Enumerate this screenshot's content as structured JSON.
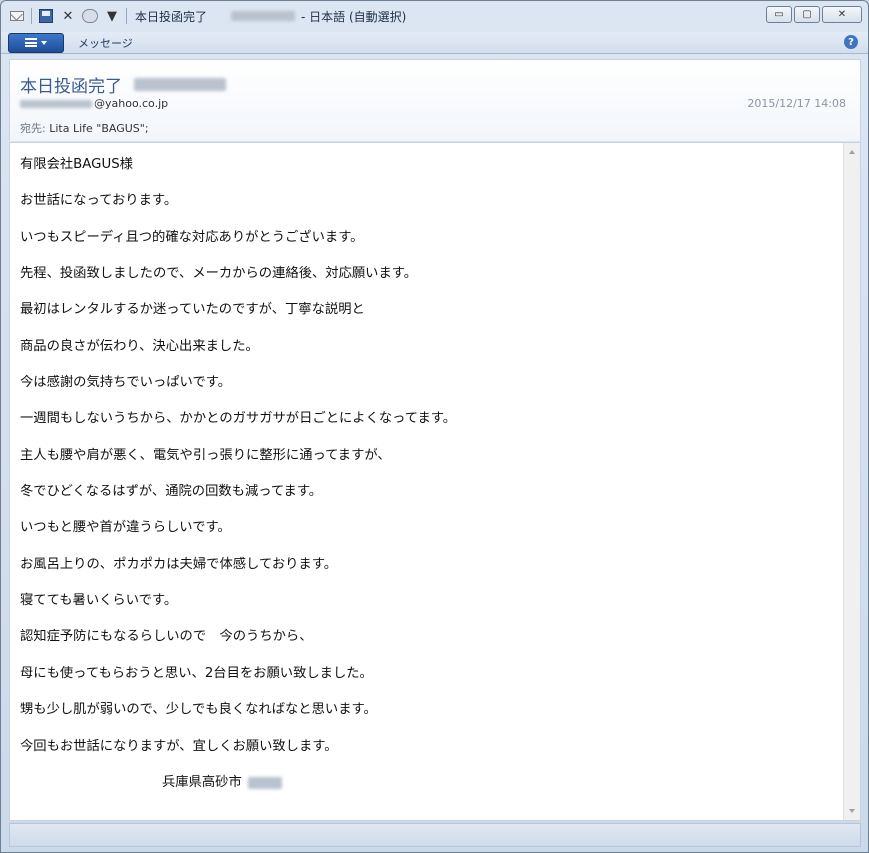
{
  "window": {
    "title": "本日投函完了",
    "title_suffix": "- 日本語 (自動選択)",
    "minimize": "▭",
    "maximize": "▢",
    "close": "✕"
  },
  "ribbon": {
    "tab_message": "メッセージ",
    "help": "?"
  },
  "header": {
    "subject": "本日投函完了",
    "from_domain": "@yahoo.co.jp",
    "date": "2015/12/17 14:08",
    "to_label": "宛先:",
    "to_value": "Lita Life \"BAGUS\";"
  },
  "body": {
    "lines": [
      "有限会社BAGUS様",
      "お世話になっております。",
      "いつもスピーディ且つ的確な対応ありがとうございます。",
      "先程、投函致しましたので、メーカからの連絡後、対応願います。",
      "最初はレンタルするか迷っていたのですが、丁寧な説明と",
      "商品の良さが伝わり、決心出来ました。",
      "今は感謝の気持ちでいっぱいです。",
      "一週間もしないうちから、かかとのガサガサが日ごとによくなってます。",
      "主人も腰や肩が悪く、電気や引っ張りに整形に通ってますが、",
      "冬でひどくなるはずが、通院の回数も減ってます。",
      "いつもと腰や首が違うらしいです。",
      "お風呂上りの、ポカポカは夫婦で体感しております。",
      "寝てても暑いくらいです。",
      "認知症予防にもなるらしいので　今のうちから、",
      "母にも使ってもらおうと思い、2台目をお願い致しました。",
      "甥も少し肌が弱いので、少しでも良くなればなと思います。",
      "今回もお世話になりますが、宜しくお願い致します。"
    ],
    "signature": "兵庫県高砂市"
  }
}
